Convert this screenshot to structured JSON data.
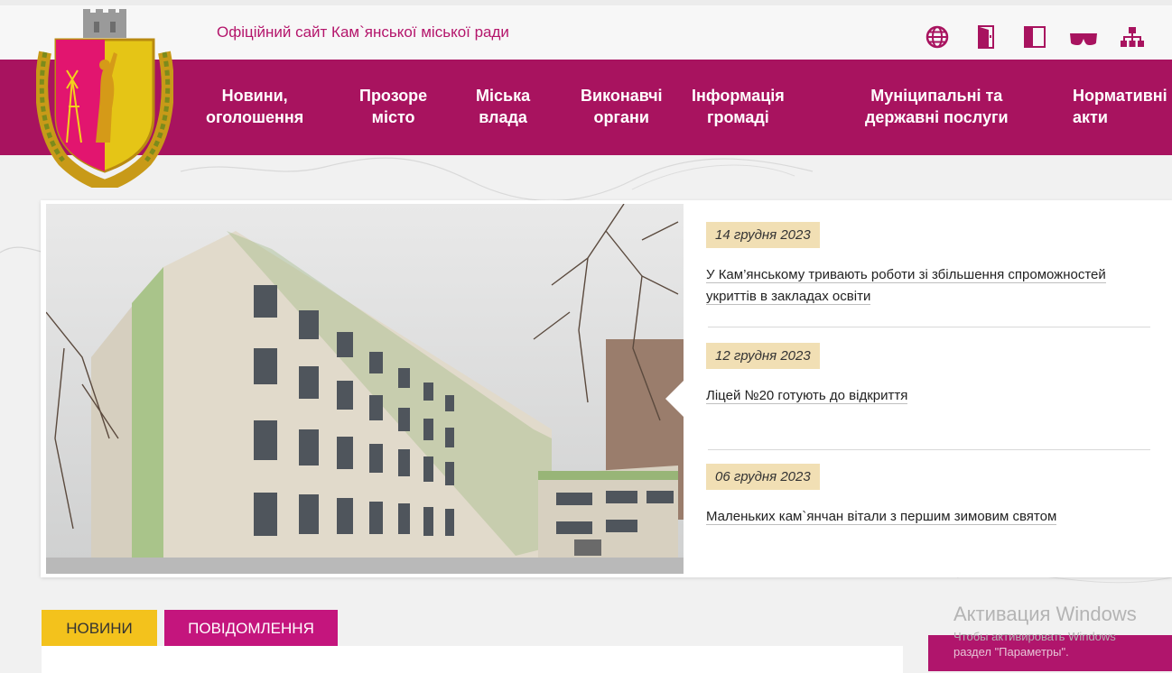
{
  "header": {
    "site_title": "Офіційний сайт Кам`янської міської ради",
    "tools": [
      {
        "icon": "globe-icon"
      },
      {
        "icon": "door-exit-icon"
      },
      {
        "icon": "contrast-icon"
      },
      {
        "icon": "glasses-icon"
      },
      {
        "icon": "sitemap-icon"
      }
    ]
  },
  "nav": {
    "items": [
      {
        "label": "Новини,\nоголошення"
      },
      {
        "label": "Прозоре\nмісто"
      },
      {
        "label": "Міська\nвлада"
      },
      {
        "label": "Виконавчі\nоргани"
      },
      {
        "label": "Інформація\nгромаді"
      },
      {
        "label": "Муніципальні та\nдержавні послуги"
      },
      {
        "label": "Нормативні\nакти"
      }
    ]
  },
  "slider": {
    "news": [
      {
        "date": "14 грудня 2023",
        "title": "У Кам’янському тривають роботи зі збільшення спроможностей укриттів в закладах освіти"
      },
      {
        "date": "12 грудня 2023",
        "title": "Ліцей №20 готують до відкриття"
      },
      {
        "date": "06 грудня 2023",
        "title": "Маленьких кам`янчан вітали з першим зимовим святом"
      }
    ]
  },
  "tabs": {
    "news_label": "НОВИНИ",
    "messages_label": "ПОВІДОМЛЕННЯ"
  },
  "activation": {
    "title": "Активация Windows",
    "line1": "Чтобы активировать Windows",
    "line2": "раздел \"Параметры\"."
  },
  "colors": {
    "brand": "#a8135f",
    "accent_yellow": "#f3c21c",
    "tab_magenta": "#c4157d",
    "date_badge": "#f1dfb4"
  }
}
